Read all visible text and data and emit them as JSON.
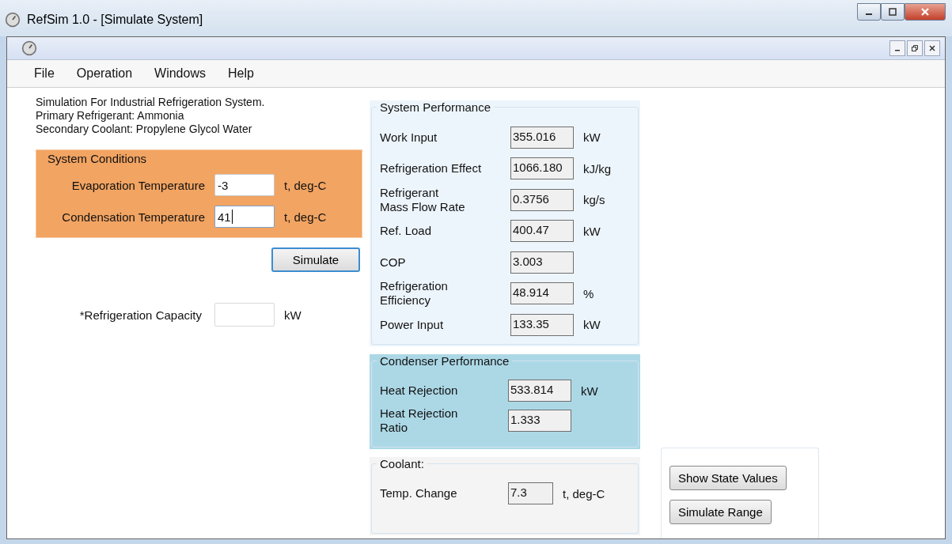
{
  "window": {
    "title": "RefSim 1.0 - [Simulate System]"
  },
  "menu": [
    {
      "label": "File"
    },
    {
      "label": "Operation"
    },
    {
      "label": "Windows"
    },
    {
      "label": "Help"
    }
  ],
  "intro": [
    "Simulation For Industrial Refrigeration System.",
    "Primary Refrigerant: Ammonia",
    "Secondary Coolant: Propylene Glycol Water"
  ],
  "system_conditions": {
    "title": "System Conditions",
    "fields": [
      {
        "label": "Evaporation Temperature",
        "value": "-3",
        "unit": "t, deg-C",
        "focused": false
      },
      {
        "label": "Condensation Temperature",
        "value": "41",
        "unit": "t, deg-C",
        "focused": true
      }
    ]
  },
  "simulate_button": "Simulate",
  "capacity": {
    "label": "*Refrigeration Capacity",
    "unit": "kW"
  },
  "system_performance": {
    "title": "System Performance",
    "rows": [
      {
        "label": "Work Input",
        "value": "355.016",
        "unit": "kW"
      },
      {
        "label": "Refrigeration Effect",
        "value": "1066.180",
        "unit": "kJ/kg"
      },
      {
        "label": "Refrigerant\nMass Flow Rate",
        "value": "0.3756",
        "unit": "kg/s"
      },
      {
        "label": "Ref. Load",
        "value": "400.47",
        "unit": "kW"
      },
      {
        "label": "COP",
        "value": "3.003"
      },
      {
        "label": "Refrigeration\nEfficiency",
        "value": "48.914",
        "unit": "%"
      },
      {
        "label": "Power Input",
        "value": "133.35",
        "unit": "kW"
      }
    ]
  },
  "condenser_performance": {
    "title": "Condenser Performance",
    "rows": [
      {
        "label": "Heat Rejection",
        "value": "533.814",
        "unit": "kW"
      },
      {
        "label": "Heat Rejection\nRatio",
        "value": "1.333"
      }
    ]
  },
  "coolant": {
    "title": "Coolant:",
    "rows": [
      {
        "label": "Temp. Change",
        "value": "7.3",
        "unit": "t, deg-C"
      }
    ]
  },
  "side_buttons": [
    "Show State Values",
    "Simulate Range"
  ]
}
